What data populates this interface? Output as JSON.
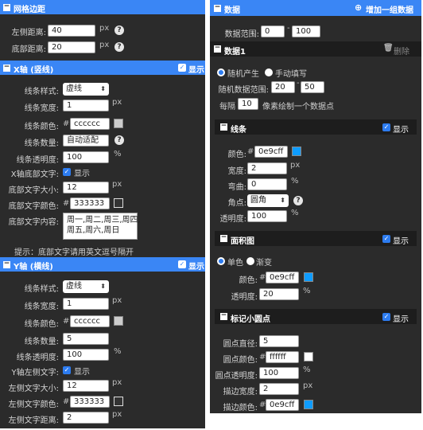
{
  "left": {
    "grid": {
      "title": "网格边距",
      "left_label": "左侧距离:",
      "left_value": "40",
      "left_unit": "px",
      "bottom_label": "底部距离:",
      "bottom_value": "20",
      "bottom_unit": "px"
    },
    "xaxis": {
      "title": "X轴 (竖线)",
      "show": "显示",
      "style_label": "线条样式:",
      "style_value": "虚线",
      "width_label": "线条宽度:",
      "width_value": "1",
      "width_unit": "px",
      "color_label": "线条颜色:",
      "color_hash": "#",
      "color_value": "cccccc",
      "color_hex": "#cccccc",
      "count_label": "线条数量:",
      "count_value": "自动适配",
      "opacity_label": "线条透明度:",
      "opacity_value": "100",
      "opacity_unit": "%",
      "text_label": "X轴底部文字:",
      "text_show": "显示",
      "fontsize_label": "底部文字大小:",
      "fontsize_value": "12",
      "fontsize_unit": "px",
      "fontcolor_label": "底部文字颜色:",
      "fontcolor_hash": "#",
      "fontcolor_value": "333333",
      "fontcolor_hex": "#333333",
      "content_label": "底部文字内容:",
      "content_value": "周一,周二,周三,周四,\n周五,周六,周日",
      "hint": "提示：底部文字请用英文逗号隔开"
    },
    "yaxis": {
      "title": "Y轴 (横线)",
      "show": "显示",
      "style_label": "线条样式:",
      "style_value": "虚线",
      "width_label": "线条宽度:",
      "width_value": "1",
      "width_unit": "px",
      "color_label": "线条颜色:",
      "color_hash": "#",
      "color_value": "cccccc",
      "color_hex": "#cccccc",
      "count_label": "线条数量:",
      "count_value": "5",
      "opacity_label": "线条透明度:",
      "opacity_value": "100",
      "opacity_unit": "%",
      "text_label": "Y轴左侧文字:",
      "text_show": "显示",
      "fontsize_label": "左侧文字大小:",
      "fontsize_value": "12",
      "fontsize_unit": "px",
      "fontcolor_label": "左侧文字颜色:",
      "fontcolor_hash": "#",
      "fontcolor_value": "333333",
      "fontcolor_hex": "#333333",
      "dist_label": "左侧文字距离:",
      "dist_value": "2",
      "dist_unit": "px"
    }
  },
  "right": {
    "data": {
      "title": "数据",
      "add_label": "增加一组数据",
      "range_label": "数据范围:",
      "range_min": "0",
      "range_max": "100"
    },
    "set1": {
      "title": "数据1",
      "delete_label": "删除",
      "random_label": "随机产生",
      "manual_label": "手动填写",
      "rand_range_label": "随机数据范围:",
      "rand_min": "20",
      "rand_max": "50",
      "every_label": "每隔",
      "every_value": "10",
      "every_suffix": "像素绘制一个数据点"
    },
    "line": {
      "title": "线条",
      "show": "显示",
      "color_label": "颜色:",
      "color_hash": "#",
      "color_value": "0e9cff",
      "color_hex": "#0e9cff",
      "width_label": "宽度:",
      "width_value": "2",
      "width_unit": "px",
      "curve_label": "弯曲:",
      "curve_value": "0",
      "curve_unit": "%",
      "corner_label": "角点:",
      "corner_value": "圆角",
      "opacity_label": "透明度:",
      "opacity_value": "100",
      "opacity_unit": "%"
    },
    "area": {
      "title": "面积图",
      "show": "显示",
      "solid_label": "单色",
      "gradient_label": "渐变",
      "color_label": "颜色:",
      "color_hash": "#",
      "color_value": "0e9cff",
      "color_hex": "#0e9cff",
      "opacity_label": "透明度:",
      "opacity_value": "20",
      "opacity_unit": "%"
    },
    "dots": {
      "title": "标记小圆点",
      "show": "显示",
      "diameter_label": "圆点直径:",
      "diameter_value": "5",
      "color_label": "圆点颜色:",
      "color_hash": "#",
      "color_value": "ffffff",
      "color_hex": "#ffffff",
      "opacity_label": "圆点透明度:",
      "opacity_value": "100",
      "opacity_unit": "%",
      "stroke_width_label": "描边宽度:",
      "stroke_width_value": "2",
      "stroke_width_unit": "px",
      "stroke_color_label": "描边颜色:",
      "stroke_color_hash": "#",
      "stroke_color_value": "0e9cff",
      "stroke_color_hex": "#0e9cff"
    }
  },
  "colors": {
    "accent": "#3a86f5",
    "panel": "#2b2b2b",
    "subheader": "#1d1d1d"
  }
}
